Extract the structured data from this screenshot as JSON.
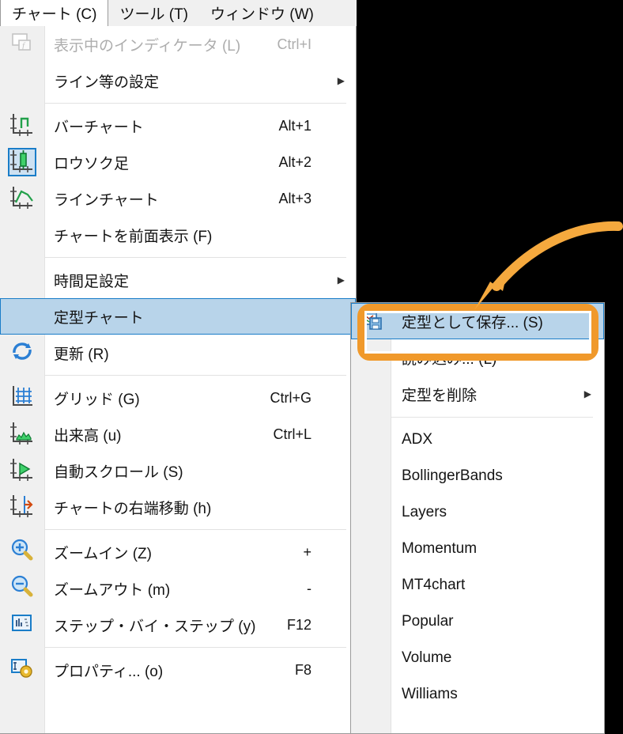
{
  "app": {
    "platform_hint": "MetaTrader chart menu"
  },
  "menubar": {
    "items": [
      {
        "label": "チャート (C)",
        "active": true
      },
      {
        "label": "ツール (T)",
        "active": false
      },
      {
        "label": "ウィンドウ (W)",
        "active": false
      }
    ]
  },
  "main_menu": {
    "items": [
      {
        "label": "表示中のインディケータ (L)",
        "accel": "Ctrl+I",
        "icon": "indicator-list-icon",
        "disabled": true,
        "arrow": false,
        "selected": false
      },
      {
        "label": "ライン等の設定",
        "accel": "",
        "icon": "",
        "disabled": false,
        "arrow": true,
        "selected": false
      },
      {
        "separator": true
      },
      {
        "label": "バーチャート",
        "accel": "Alt+1",
        "icon": "bar-chart-icon",
        "disabled": false,
        "arrow": false,
        "selected": false
      },
      {
        "label": "ロウソク足",
        "accel": "Alt+2",
        "icon": "candlestick-chart-icon",
        "disabled": false,
        "arrow": false,
        "selected": false,
        "icon_selected": true
      },
      {
        "label": "ラインチャート",
        "accel": "Alt+3",
        "icon": "line-chart-icon",
        "disabled": false,
        "arrow": false,
        "selected": false
      },
      {
        "label": "チャートを前面表示 (F)",
        "accel": "",
        "icon": "",
        "disabled": false,
        "arrow": false,
        "selected": false
      },
      {
        "separator": true
      },
      {
        "label": "時間足設定",
        "accel": "",
        "icon": "",
        "disabled": false,
        "arrow": true,
        "selected": false
      },
      {
        "label": "定型チャート",
        "accel": "",
        "icon": "",
        "disabled": false,
        "arrow": false,
        "selected": true
      },
      {
        "label": "更新 (R)",
        "accel": "",
        "icon": "refresh-icon",
        "disabled": false,
        "arrow": false,
        "selected": false
      },
      {
        "separator": true
      },
      {
        "label": "グリッド (G)",
        "accel": "Ctrl+G",
        "icon": "grid-icon",
        "disabled": false,
        "arrow": false,
        "selected": false
      },
      {
        "label": "出来高 (u)",
        "accel": "Ctrl+L",
        "icon": "volume-icon",
        "disabled": false,
        "arrow": false,
        "selected": false
      },
      {
        "label": "自動スクロール (S)",
        "accel": "",
        "icon": "auto-scroll-icon",
        "disabled": false,
        "arrow": false,
        "selected": false
      },
      {
        "label": "チャートの右端移動 (h)",
        "accel": "",
        "icon": "chart-shift-icon",
        "disabled": false,
        "arrow": false,
        "selected": false
      },
      {
        "separator": true
      },
      {
        "label": "ズームイン (Z)",
        "accel": "+",
        "icon": "zoom-in-icon",
        "disabled": false,
        "arrow": false,
        "selected": false
      },
      {
        "label": "ズームアウト (m)",
        "accel": "-",
        "icon": "zoom-out-icon",
        "disabled": false,
        "arrow": false,
        "selected": false
      },
      {
        "label": "ステップ・バイ・ステップ (y)",
        "accel": "F12",
        "icon": "step-by-step-icon",
        "disabled": false,
        "arrow": false,
        "selected": false
      },
      {
        "separator": true
      },
      {
        "label": "プロパティ... (o)",
        "accel": "F8",
        "icon": "properties-icon",
        "disabled": false,
        "arrow": false,
        "selected": false
      }
    ]
  },
  "submenu": {
    "items": [
      {
        "label": "定型として保存... (S)",
        "icon": "save-template-icon",
        "arrow": false,
        "selected": true
      },
      {
        "label": "読み込み... (L)",
        "icon": "",
        "arrow": false,
        "selected": false
      },
      {
        "label": "定型を削除",
        "icon": "",
        "arrow": true,
        "selected": false
      },
      {
        "separator": true
      },
      {
        "label": "ADX",
        "icon": "",
        "arrow": false,
        "selected": false
      },
      {
        "label": "BollingerBands",
        "icon": "",
        "arrow": false,
        "selected": false
      },
      {
        "label": "Layers",
        "icon": "",
        "arrow": false,
        "selected": false
      },
      {
        "label": "Momentum",
        "icon": "",
        "arrow": false,
        "selected": false
      },
      {
        "label": "MT4chart",
        "icon": "",
        "arrow": false,
        "selected": false
      },
      {
        "label": "Popular",
        "icon": "",
        "arrow": false,
        "selected": false
      },
      {
        "label": "Volume",
        "icon": "",
        "arrow": false,
        "selected": false
      },
      {
        "label": "Williams",
        "icon": "",
        "arrow": false,
        "selected": false
      }
    ]
  },
  "annotation": {
    "highlight_color": "#F0992B",
    "arrow_color": "#F5A93E",
    "arrow_name": "curved-arrow-annotation",
    "highlight_target": "定型として保存... (S)"
  },
  "colors": {
    "selection_fill": "#b8d4ea",
    "selection_border": "#1a7dc8",
    "menu_background": "#ffffff",
    "gutter_background": "#f0f0f0",
    "page_background": "#000000"
  }
}
